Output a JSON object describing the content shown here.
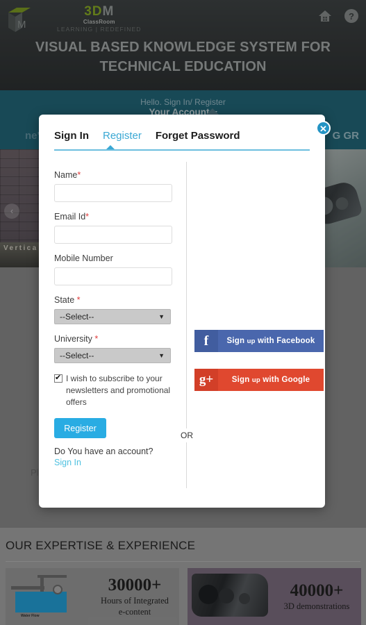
{
  "header": {
    "logo": {
      "three_d_m": "3DM",
      "classroom": "ClassRoom",
      "tagline": "LEARNING | REDEFINED"
    },
    "icons": {
      "home": "home-icon",
      "help": "help-icon"
    },
    "tagline": "VISUAL BASED KNOWLEDGE SYSTEM FOR TECHNICAL EDUCATION"
  },
  "account_bar": {
    "hello": "Hello. Sign In/ Register",
    "your_account": "Your Account",
    "nav_left_partial": "ne\"",
    "nav_right_partial": "G GR"
  },
  "hero": {
    "caption": "Vertica",
    "prev_arrow": "‹"
  },
  "background": {
    "ghost_text": "Pl"
  },
  "modal": {
    "close": "✕",
    "tabs": [
      {
        "label": "Sign In",
        "active": false
      },
      {
        "label": "Register",
        "active": true
      },
      {
        "label": "Forget Password",
        "active": false
      }
    ],
    "or_label": "OR",
    "fields": [
      {
        "label": "Name",
        "required": true,
        "value": "",
        "placeholder": ""
      },
      {
        "label": "Email Id",
        "required": true,
        "value": "",
        "placeholder": ""
      },
      {
        "label": "Mobile Number",
        "required": false,
        "value": "",
        "placeholder": ""
      }
    ],
    "selects": [
      {
        "label": "State",
        "required": true,
        "value": "--Select--",
        "caret": "▼"
      },
      {
        "label": "University",
        "required": true,
        "value": "--Select--",
        "caret": "▼"
      }
    ],
    "required_marker": "*",
    "subscribe": {
      "checked": true,
      "text": "I wish to subscribe to your newsletters and promotional offers"
    },
    "register_button": "Register",
    "have_account_text": "Do You have an account?",
    "sign_in_link": "Sign In",
    "social": [
      {
        "id": "facebook",
        "icon": "f",
        "label_main": "Sign ",
        "label_small": "up",
        "label_end": " with Facebook",
        "color": "#4a67ad"
      },
      {
        "id": "google",
        "icon": "g+",
        "label_main": "Sign ",
        "label_small": "up",
        "label_end": " with Google",
        "color": "#e0482f"
      }
    ]
  },
  "expertise": {
    "title": "OUR EXPERTISE & EXPERIENCE",
    "cards": [
      {
        "number": "30000+",
        "subtitle_line1": "Hours of Integrated",
        "subtitle_line2": "e-content",
        "art_label": "Water Flow"
      },
      {
        "number": "40000+",
        "subtitle_line1": "3D demonstrations",
        "subtitle_line2": "",
        "art_label": ""
      }
    ]
  },
  "colors": {
    "teal": "#1b6479",
    "accent_blue": "#29ace3",
    "facebook": "#4a67ad",
    "google": "#e0482f",
    "logo_green": "#8ab01e"
  }
}
